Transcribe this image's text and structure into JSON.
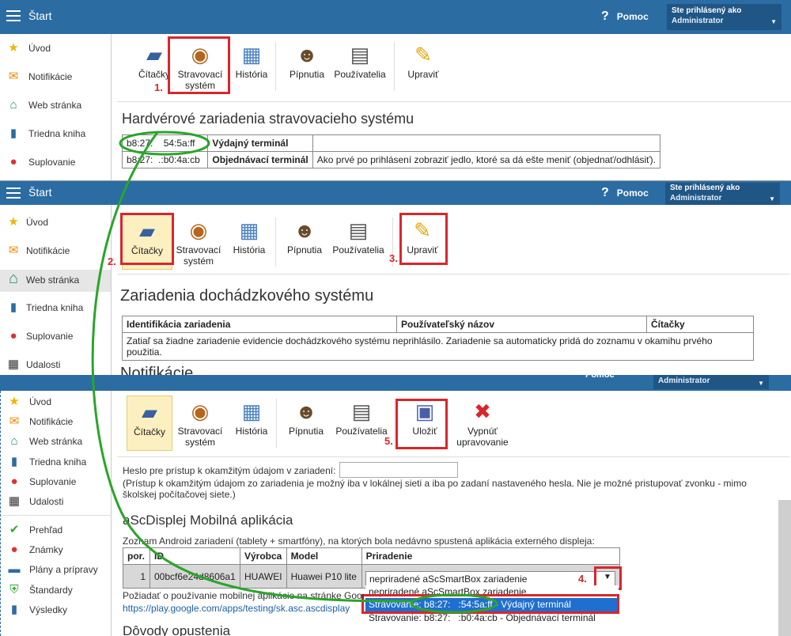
{
  "app": {
    "title": "Štart",
    "help": "Pomoc",
    "user_label": "Ste prihlásený ako",
    "user_name": "Administrator"
  },
  "sidebar": {
    "items": [
      "Úvod",
      "Notifikácie",
      "Web stránka",
      "Triedna kniha",
      "Suplovanie",
      "Udalosti"
    ],
    "extra": [
      "Prehľad",
      "Známky",
      "Plány a prípravy",
      "Štandardy",
      "Výsledky"
    ]
  },
  "toolbar": {
    "citacky": "Čítačky",
    "stravovaci": "Stravovací systém",
    "historia": "História",
    "pipnutia": "Pípnutia",
    "pouzivatelia": "Používatelia",
    "upravit": "Upraviť",
    "ulozit": "Uložiť",
    "vypnut": "Vypnúť upravovanie"
  },
  "steps": [
    "1.",
    "2.",
    "3.",
    "4.",
    "5."
  ],
  "panel1": {
    "heading": "Hardvérové zariadenia stravovacieho systému",
    "rows": [
      {
        "id": "b8:27:    54:5a:ff",
        "name": "Výdajný terminál",
        "desc": ""
      },
      {
        "id": "b8:27:  .:b0:4a:cb",
        "name": "Objednávací terminál",
        "desc": "Ako prvé po prihlásení zobraziť jedlo, ktoré sa dá ešte meniť (objednať/odhlásiť)."
      }
    ]
  },
  "panel2": {
    "heading": "Zariadenia dochádzkového systému",
    "headers": [
      "Identifikácia zariadenia",
      "Používateľský názov",
      "Čítačky"
    ],
    "empty": "Zatiaľ sa žiadne zariadenie evidencie dochádzkového systému neprihlásilo. Zariadenie sa automaticky pridá do zoznamu v okamihu prvého použitia.",
    "next": "Notifikácie"
  },
  "panel3": {
    "pwd_label": "Heslo pre prístup k okamžitým údajom v zariadení:",
    "pwd_note": "(Prístup k okamžitým údajom zo zariadenia je možný iba v lokálnej sieti a iba po zadaní nastaveného hesla. Nie je možné pristupovať zvonku - mimo školskej počítačovej siete.)",
    "section": "aScDisplej Mobilná aplikácia",
    "list_note": "Zoznam Android zariadení (tablety + smartfóny), na ktorých bola nedávno spustená aplikácia externého displeja:",
    "headers": [
      "por.",
      "ID",
      "Výrobca",
      "Model",
      "Priradenie"
    ],
    "row": {
      "por": "1",
      "id": "00bcf6e24d8606a1",
      "vyrobca": "HUAWEI",
      "model": "Huawei P10 lite",
      "priradenie": "nepriradené aScSmartBox zariadenie"
    },
    "options": [
      "nepriradené aScSmartBox zariadenie",
      "Stravovanie: b8:27:   :54:5a:ff - Výdajný terminál",
      "Stravovanie: b8:27:   :b0:4a:cb - Objednávací terminál"
    ],
    "request": "Požiadať o používanie mobilnej aplikácie na stránke Google",
    "link": "https://play.google.com/apps/testing/sk.asc.ascdisplay",
    "next": "Dôvody opustenia"
  }
}
